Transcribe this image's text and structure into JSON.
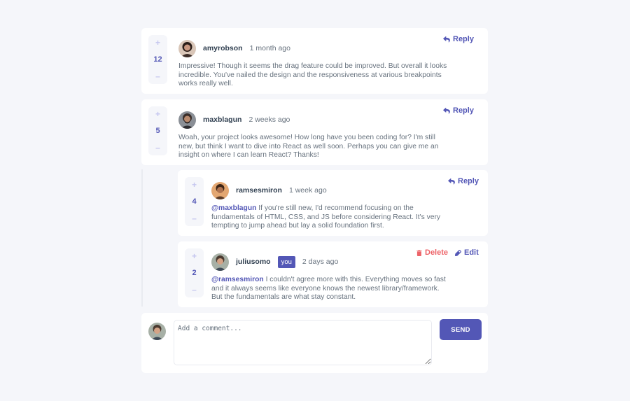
{
  "comments": [
    {
      "score": "12",
      "username": "amyrobson",
      "time": "1 month ago",
      "action": "Reply",
      "content": "Impressive! Though it seems the drag feature could be improved. But overall it looks incredible. You've nailed the design and the responsiveness at various breakpoints works really well."
    },
    {
      "score": "5",
      "username": "maxblagun",
      "time": "2 weeks ago",
      "action": "Reply",
      "content": "Woah, your project looks awesome! How long have you been coding for? I'm still new, but think I want to dive into React as well soon. Perhaps you can give me an insight on where I can learn React? Thanks!"
    }
  ],
  "replies": [
    {
      "score": "4",
      "username": "ramsesmiron",
      "time": "1 week ago",
      "action": "Reply",
      "mention": "@maxblagun",
      "content": " If you're still new, I'd recommend focusing on the fundamentals of HTML, CSS, and JS before considering React. It's very tempting to jump ahead but lay a solid foundation first."
    },
    {
      "score": "2",
      "username": "juliusomo",
      "badge": "you",
      "time": "2 days ago",
      "delete_label": "Delete",
      "edit_label": "Edit",
      "mention": "@ramsesmiron",
      "content": " I couldn't agree more with this. Everything moves so fast and it always seems like everyone knows the newest library/framework. But the fundamentals are what stay constant."
    }
  ],
  "vote": {
    "plus": "+",
    "minus": "–"
  },
  "new_comment": {
    "placeholder": "Add a comment...",
    "send_label": "SEND"
  },
  "colors": {
    "accent": "#5357b6",
    "accent_light": "#c5c6ef",
    "danger": "#ed6368",
    "background": "#f5f6fa",
    "dark_text": "#324152",
    "body_text": "#67727e"
  },
  "icons": {
    "reply": "reply-icon",
    "delete": "trash-icon",
    "edit": "pencil-icon",
    "upvote": "plus-icon",
    "downvote": "minus-icon"
  }
}
